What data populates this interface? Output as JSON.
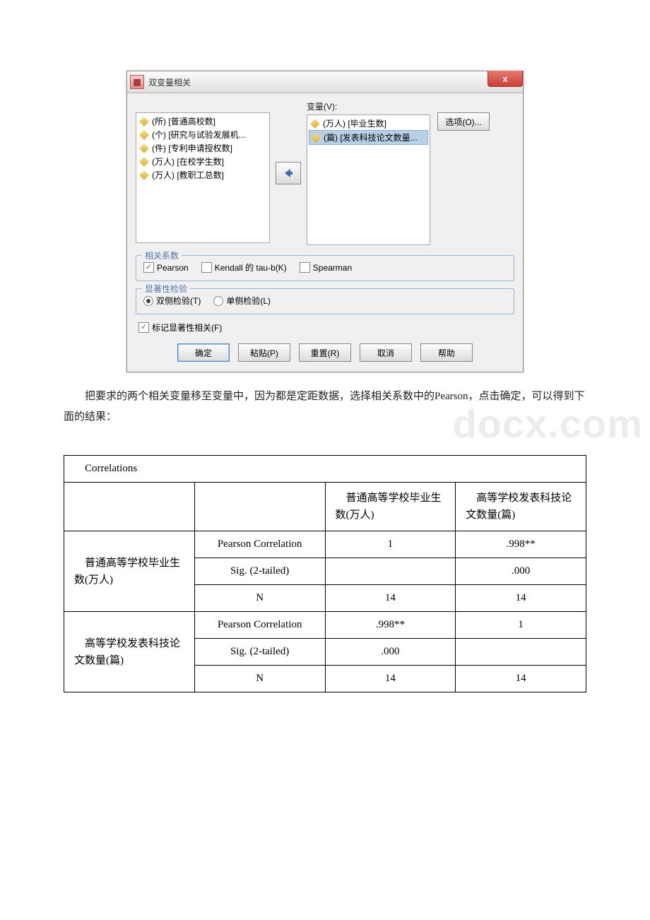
{
  "dialog": {
    "title": "双变量相关",
    "close": "x",
    "left_list": [
      "(所) [普通高校数]",
      "(个) [研究与试验发展机...",
      "(件) [专利申请授权数]",
      "(万人) [在校学生数]",
      "(万人) [教职工总数]"
    ],
    "right_label": "变量(V):",
    "right_list": [
      "(万人) [毕业生数]",
      "(篇) [发表科技论文数量..."
    ],
    "options_btn": "选项(O)...",
    "group_coef": "相关系数",
    "coef_pearson": "Pearson",
    "coef_kendall": "Kendall 的 tau-b(K)",
    "coef_spearman": "Spearman",
    "group_sig": "显著性检验",
    "sig_two": "双侧检验(T)",
    "sig_one": "单侧检验(L)",
    "flag_sig": "标记显著性相关(F)",
    "btn_ok": "确定",
    "btn_paste": "粘贴(P)",
    "btn_reset": "重置(R)",
    "btn_cancel": "取消",
    "btn_help": "帮助"
  },
  "paragraph": "把要求的两个相关变量移至变量中，因为都是定距数据，选择相关系数中的Pearson，点击确定，可以得到下面的结果：",
  "watermark": "docx.com",
  "table": {
    "title": "Correlations",
    "col1": "普通高等学校毕业生数(万人)",
    "col2": "高等学校发表科技论文数量(篇)",
    "row1_label": "普通高等学校毕业生数(万人)",
    "row2_label": "高等学校发表科技论文数量(篇)",
    "stat_pearson": "Pearson Correlation",
    "stat_sig": "Sig. (2-tailed)",
    "stat_n": "N",
    "r1_pearson_c1": "1",
    "r1_pearson_c2": ".998**",
    "r1_sig_c1": "",
    "r1_sig_c2": ".000",
    "r1_n_c1": "14",
    "r1_n_c2": "14",
    "r2_pearson_c1": ".998**",
    "r2_pearson_c2": "1",
    "r2_sig_c1": ".000",
    "r2_sig_c2": "",
    "r2_n_c1": "14",
    "r2_n_c2": "14"
  }
}
